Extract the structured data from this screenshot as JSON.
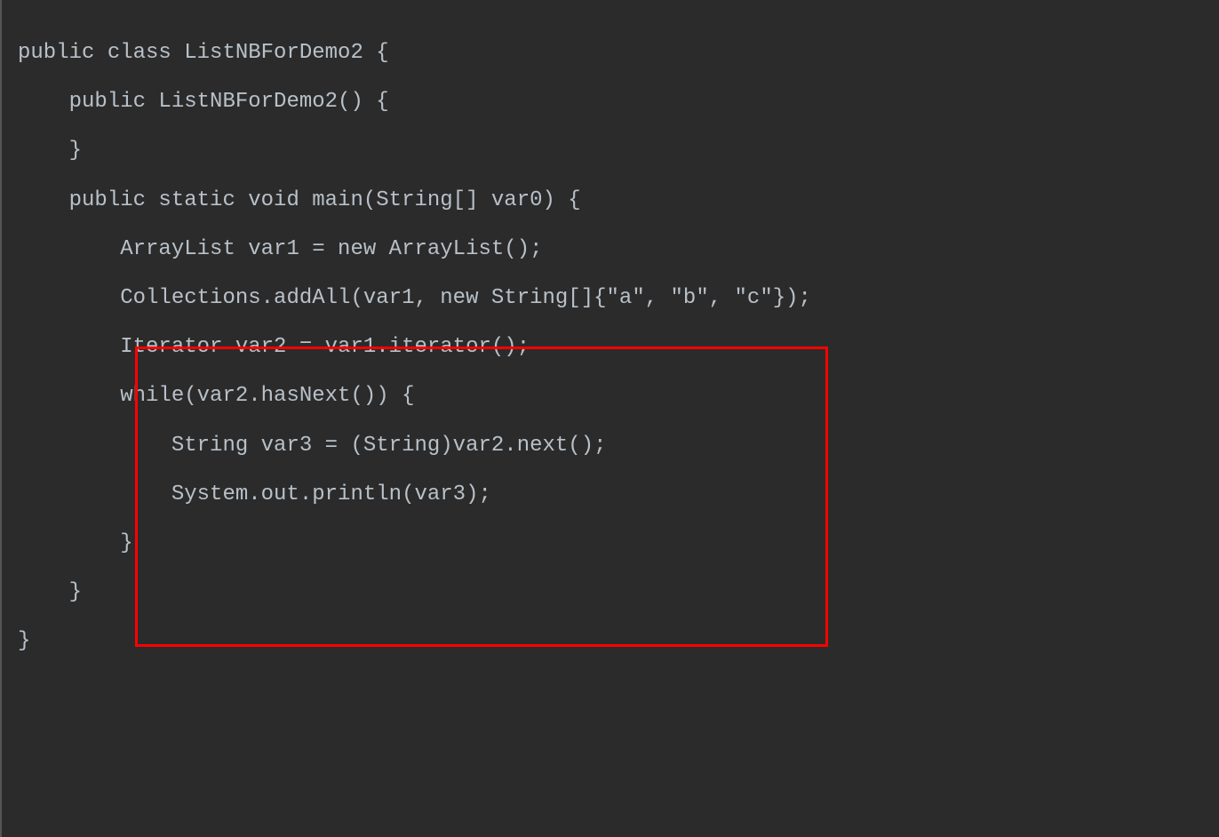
{
  "code": {
    "line1": "public class ListNBForDemo2 {",
    "line2": "    public ListNBForDemo2() {",
    "line3": "    }",
    "line4": "",
    "line5": "    public static void main(String[] var0) {",
    "line6": "        ArrayList var1 = new ArrayList();",
    "line7": "        Collections.addAll(var1, new String[]{\"a\", \"b\", \"c\"});",
    "line8": "        Iterator var2 = var1.iterator();",
    "line9": "",
    "line10": "        while(var2.hasNext()) {",
    "line11": "            String var3 = (String)var2.next();",
    "line12": "            System.out.println(var3);",
    "line13": "        }",
    "line14": "",
    "line15": "    }",
    "line16": "}"
  }
}
